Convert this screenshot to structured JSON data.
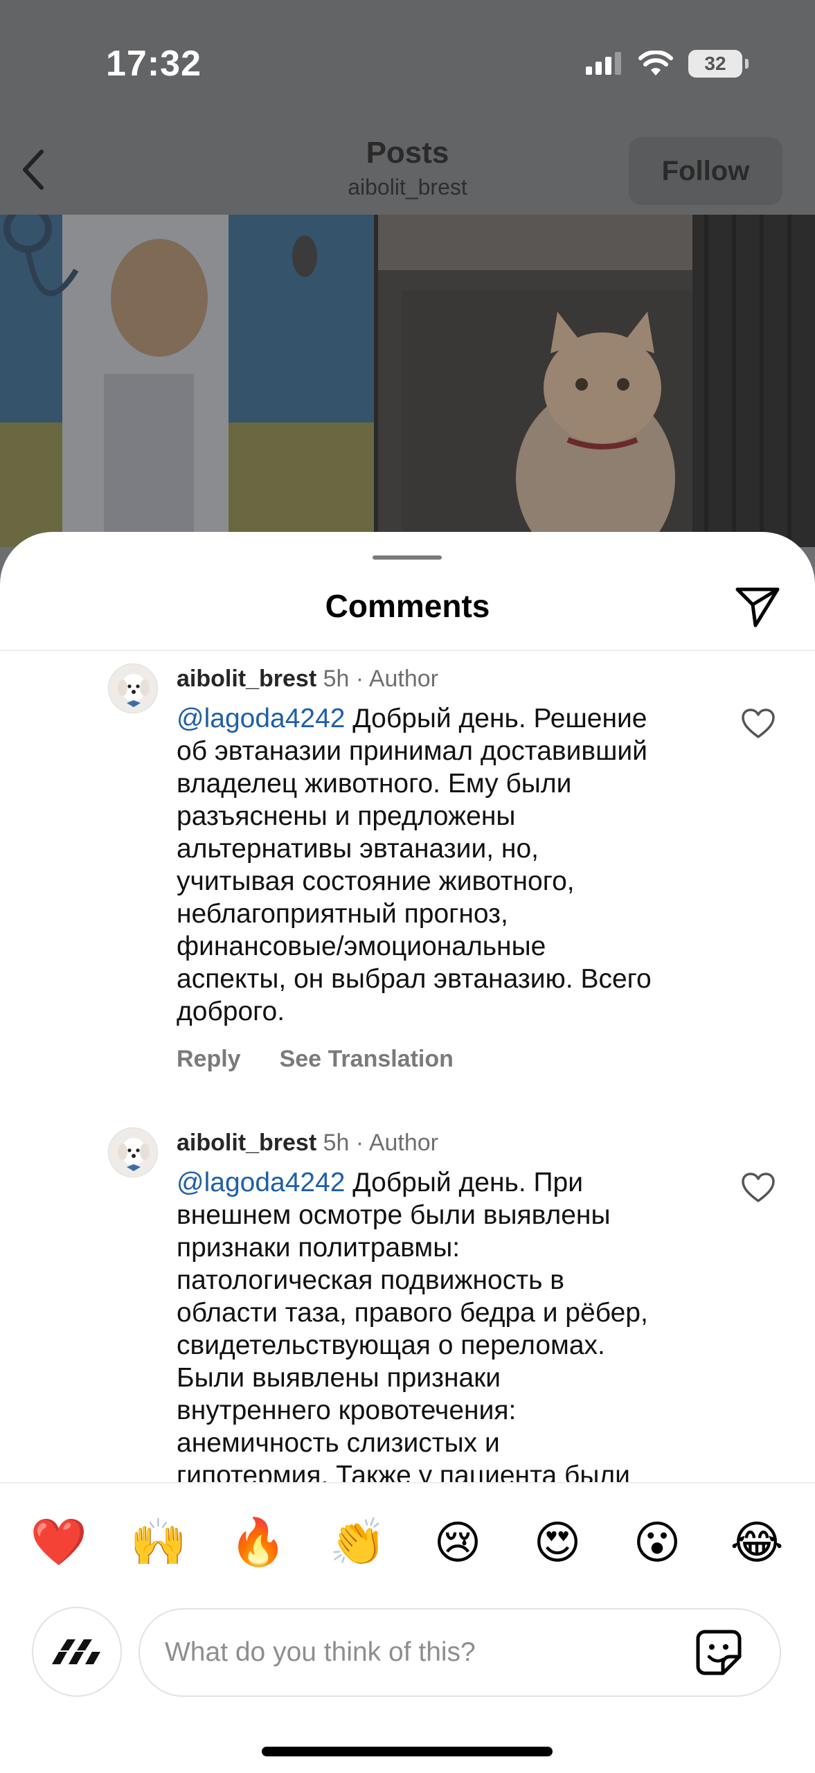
{
  "status_bar": {
    "time": "17:32",
    "battery": "32"
  },
  "nav": {
    "title": "Posts",
    "subtitle": "aibolit_brest",
    "follow_label": "Follow"
  },
  "sheet": {
    "title": "Comments"
  },
  "comments": [
    {
      "username": "aibolit_brest",
      "time": "5h",
      "separator": "·",
      "badge": "Author",
      "mention": "@lagoda4242",
      "lines": [
        " Добрый день. Решение",
        "об эвтаназии принимал доставивший",
        "владелец животного. Ему были",
        "разъяснены и предложены",
        "альтернативы эвтаназии, но,",
        "учитывая состояние животного,",
        "неблагоприятный прогноз,",
        "финансовые/эмоциональные",
        "аспекты, он выбрал эвтаназию. Всего",
        "доброго."
      ],
      "reply_label": "Reply",
      "translate_label": "See Translation"
    },
    {
      "username": "aibolit_brest",
      "time": "5h",
      "separator": "·",
      "badge": "Author",
      "mention": "@lagoda4242",
      "lines": [
        " Добрый день. При",
        "внешнем осмотре были выявлены",
        "признаки политравмы:",
        "патологическая подвижность в",
        "области таза, правого бедра и рёбер,",
        "свидетельствующая о переломах.",
        "Были выявлены признаки",
        "внутреннего кровотечения:",
        "анемичность слизистых и",
        "гипотермия. Также у пациента были"
      ]
    }
  ],
  "reactions": [
    "❤️",
    "🙌",
    "🔥",
    "👏",
    "😢",
    "😍",
    "😮",
    "😂"
  ],
  "composer": {
    "placeholder": "What do you think of this?"
  },
  "icons": {
    "back": "chevron-left-icon",
    "share": "paper-plane-icon",
    "like": "heart-outline-icon",
    "sticker": "sticker-icon",
    "composer_avatar": "checkered-logo-icon"
  },
  "colors": {
    "mention": "#1f5fa8",
    "dim_overlay": "#636466"
  }
}
